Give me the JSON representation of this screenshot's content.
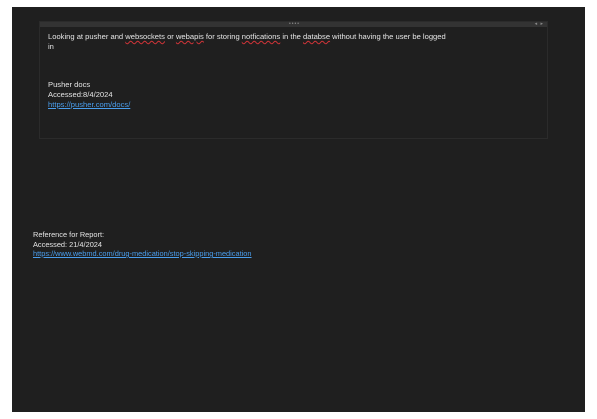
{
  "note": {
    "line1": [
      {
        "text": "Looking at pusher and ",
        "spell": false
      },
      {
        "text": "websockets",
        "spell": true
      },
      {
        "text": " or ",
        "spell": false
      },
      {
        "text": "webapis",
        "spell": true
      },
      {
        "text": " for storing ",
        "spell": false
      },
      {
        "text": "notfications",
        "spell": true
      },
      {
        "text": " in the ",
        "spell": false
      },
      {
        "text": "databse",
        "spell": true
      },
      {
        "text": " without having the user be logged",
        "spell": false
      }
    ],
    "line2": "in",
    "source_title": "Pusher docs",
    "accessed": "Accessed:8/4/2024",
    "link": "https://pusher.com/docs/"
  },
  "reference": {
    "title": "Reference for Report:",
    "accessed": "Accessed: 21/4/2024",
    "link": "https://www.webmd.com/drug-medication/stop-skipping-medication"
  },
  "colors": {
    "background": "#1f1f1f",
    "text": "#e6e6e6",
    "link": "#4a9eed",
    "spellcheck": "#d13438"
  },
  "icons": {
    "drag_handle": "drag-handle-icon",
    "resize_handle": "resize-handle-icon"
  }
}
